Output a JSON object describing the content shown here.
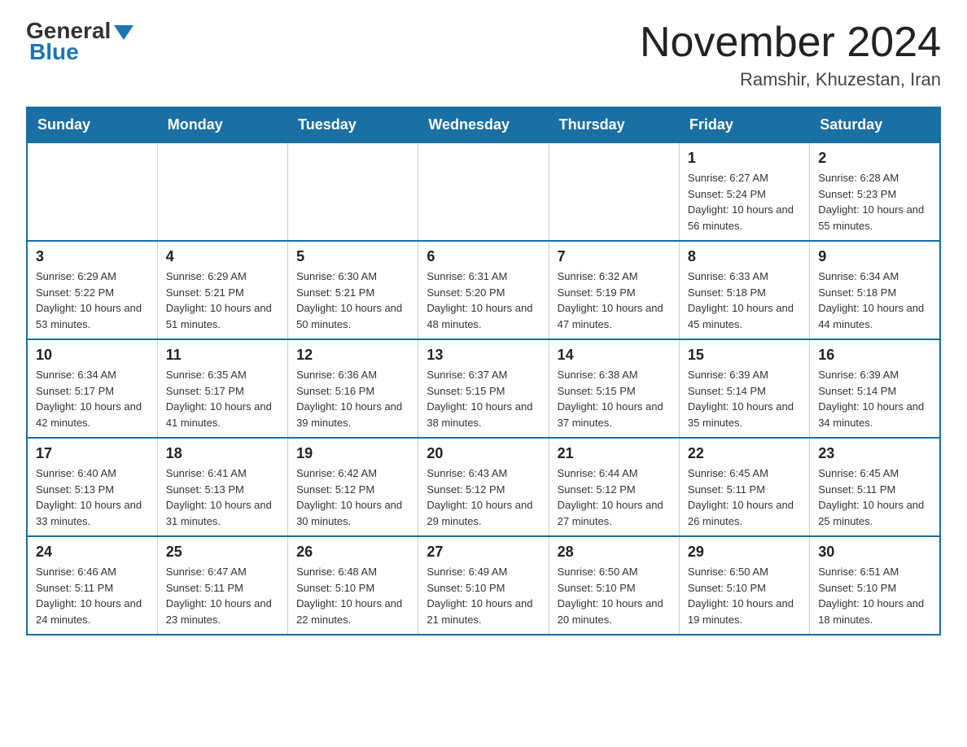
{
  "header": {
    "logo_general": "General",
    "logo_blue": "Blue",
    "month_title": "November 2024",
    "location": "Ramshir, Khuzestan, Iran"
  },
  "weekdays": [
    "Sunday",
    "Monday",
    "Tuesday",
    "Wednesday",
    "Thursday",
    "Friday",
    "Saturday"
  ],
  "weeks": [
    [
      {
        "day": "",
        "info": ""
      },
      {
        "day": "",
        "info": ""
      },
      {
        "day": "",
        "info": ""
      },
      {
        "day": "",
        "info": ""
      },
      {
        "day": "",
        "info": ""
      },
      {
        "day": "1",
        "info": "Sunrise: 6:27 AM\nSunset: 5:24 PM\nDaylight: 10 hours and 56 minutes."
      },
      {
        "day": "2",
        "info": "Sunrise: 6:28 AM\nSunset: 5:23 PM\nDaylight: 10 hours and 55 minutes."
      }
    ],
    [
      {
        "day": "3",
        "info": "Sunrise: 6:29 AM\nSunset: 5:22 PM\nDaylight: 10 hours and 53 minutes."
      },
      {
        "day": "4",
        "info": "Sunrise: 6:29 AM\nSunset: 5:21 PM\nDaylight: 10 hours and 51 minutes."
      },
      {
        "day": "5",
        "info": "Sunrise: 6:30 AM\nSunset: 5:21 PM\nDaylight: 10 hours and 50 minutes."
      },
      {
        "day": "6",
        "info": "Sunrise: 6:31 AM\nSunset: 5:20 PM\nDaylight: 10 hours and 48 minutes."
      },
      {
        "day": "7",
        "info": "Sunrise: 6:32 AM\nSunset: 5:19 PM\nDaylight: 10 hours and 47 minutes."
      },
      {
        "day": "8",
        "info": "Sunrise: 6:33 AM\nSunset: 5:18 PM\nDaylight: 10 hours and 45 minutes."
      },
      {
        "day": "9",
        "info": "Sunrise: 6:34 AM\nSunset: 5:18 PM\nDaylight: 10 hours and 44 minutes."
      }
    ],
    [
      {
        "day": "10",
        "info": "Sunrise: 6:34 AM\nSunset: 5:17 PM\nDaylight: 10 hours and 42 minutes."
      },
      {
        "day": "11",
        "info": "Sunrise: 6:35 AM\nSunset: 5:17 PM\nDaylight: 10 hours and 41 minutes."
      },
      {
        "day": "12",
        "info": "Sunrise: 6:36 AM\nSunset: 5:16 PM\nDaylight: 10 hours and 39 minutes."
      },
      {
        "day": "13",
        "info": "Sunrise: 6:37 AM\nSunset: 5:15 PM\nDaylight: 10 hours and 38 minutes."
      },
      {
        "day": "14",
        "info": "Sunrise: 6:38 AM\nSunset: 5:15 PM\nDaylight: 10 hours and 37 minutes."
      },
      {
        "day": "15",
        "info": "Sunrise: 6:39 AM\nSunset: 5:14 PM\nDaylight: 10 hours and 35 minutes."
      },
      {
        "day": "16",
        "info": "Sunrise: 6:39 AM\nSunset: 5:14 PM\nDaylight: 10 hours and 34 minutes."
      }
    ],
    [
      {
        "day": "17",
        "info": "Sunrise: 6:40 AM\nSunset: 5:13 PM\nDaylight: 10 hours and 33 minutes."
      },
      {
        "day": "18",
        "info": "Sunrise: 6:41 AM\nSunset: 5:13 PM\nDaylight: 10 hours and 31 minutes."
      },
      {
        "day": "19",
        "info": "Sunrise: 6:42 AM\nSunset: 5:12 PM\nDaylight: 10 hours and 30 minutes."
      },
      {
        "day": "20",
        "info": "Sunrise: 6:43 AM\nSunset: 5:12 PM\nDaylight: 10 hours and 29 minutes."
      },
      {
        "day": "21",
        "info": "Sunrise: 6:44 AM\nSunset: 5:12 PM\nDaylight: 10 hours and 27 minutes."
      },
      {
        "day": "22",
        "info": "Sunrise: 6:45 AM\nSunset: 5:11 PM\nDaylight: 10 hours and 26 minutes."
      },
      {
        "day": "23",
        "info": "Sunrise: 6:45 AM\nSunset: 5:11 PM\nDaylight: 10 hours and 25 minutes."
      }
    ],
    [
      {
        "day": "24",
        "info": "Sunrise: 6:46 AM\nSunset: 5:11 PM\nDaylight: 10 hours and 24 minutes."
      },
      {
        "day": "25",
        "info": "Sunrise: 6:47 AM\nSunset: 5:11 PM\nDaylight: 10 hours and 23 minutes."
      },
      {
        "day": "26",
        "info": "Sunrise: 6:48 AM\nSunset: 5:10 PM\nDaylight: 10 hours and 22 minutes."
      },
      {
        "day": "27",
        "info": "Sunrise: 6:49 AM\nSunset: 5:10 PM\nDaylight: 10 hours and 21 minutes."
      },
      {
        "day": "28",
        "info": "Sunrise: 6:50 AM\nSunset: 5:10 PM\nDaylight: 10 hours and 20 minutes."
      },
      {
        "day": "29",
        "info": "Sunrise: 6:50 AM\nSunset: 5:10 PM\nDaylight: 10 hours and 19 minutes."
      },
      {
        "day": "30",
        "info": "Sunrise: 6:51 AM\nSunset: 5:10 PM\nDaylight: 10 hours and 18 minutes."
      }
    ]
  ]
}
